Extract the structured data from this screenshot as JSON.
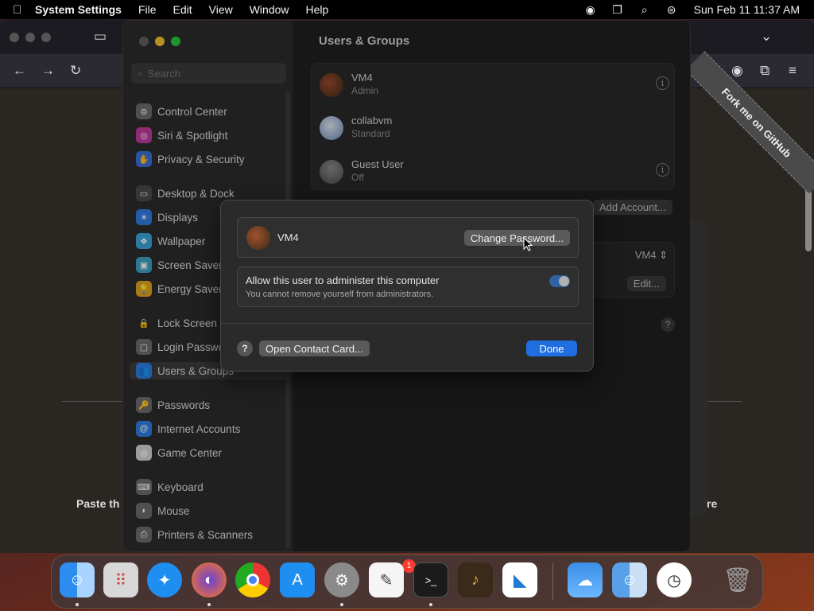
{
  "menubar": {
    "app_name": "System Settings",
    "menus": [
      "File",
      "Edit",
      "View",
      "Window",
      "Help"
    ],
    "clock": "Sun Feb 11  11:37 AM"
  },
  "browser": {
    "ribbon_text": "Fork me on GitHub",
    "page_text_left": "Paste th",
    "page_text_right": "efore"
  },
  "settings": {
    "search_placeholder": "Search",
    "sidebar_items": [
      {
        "label": "Control Center",
        "icon": "control-center-icon",
        "color": "#6b6b6b"
      },
      {
        "label": "Siri & Spotlight",
        "icon": "siri-icon",
        "color": "#c0399c"
      },
      {
        "label": "Privacy & Security",
        "icon": "hand-icon",
        "color": "#3a6fd8"
      },
      {
        "label": "Desktop & Dock",
        "icon": "dock-icon",
        "color": "#4a4a4a"
      },
      {
        "label": "Displays",
        "icon": "sun-icon",
        "color": "#2f7de0"
      },
      {
        "label": "Wallpaper",
        "icon": "wallpaper-icon",
        "color": "#3aa3d8"
      },
      {
        "label": "Screen Saver",
        "icon": "screen-saver-icon",
        "color": "#3d9fc2"
      },
      {
        "label": "Energy Saver",
        "icon": "bulb-icon",
        "color": "#e0a21f"
      },
      {
        "label": "Lock Screen",
        "icon": "lock-icon",
        "color": "#2b2b2b"
      },
      {
        "label": "Login Password",
        "icon": "login-password-icon",
        "color": "#6b6b6b"
      },
      {
        "label": "Users & Groups",
        "icon": "users-icon",
        "color": "#2f7de0"
      },
      {
        "label": "Passwords",
        "icon": "key-icon",
        "color": "#6b6b6b"
      },
      {
        "label": "Internet Accounts",
        "icon": "at-icon",
        "color": "#2f7de0"
      },
      {
        "label": "Game Center",
        "icon": "game-center-icon",
        "color": "#d0d0d0"
      },
      {
        "label": "Keyboard",
        "icon": "keyboard-icon",
        "color": "#6b6b6b"
      },
      {
        "label": "Mouse",
        "icon": "mouse-icon",
        "color": "#6b6b6b"
      },
      {
        "label": "Printers & Scanners",
        "icon": "printer-icon",
        "color": "#6b6b6b"
      }
    ],
    "main_title": "Users & Groups",
    "users": [
      {
        "name": "VM4",
        "role": "Admin"
      },
      {
        "name": "collabvm",
        "role": "Standard"
      },
      {
        "name": "Guest User",
        "role": "Off"
      }
    ],
    "add_account": "Add Account...",
    "auto_login_value": "VM4",
    "edit_label": "Edit..."
  },
  "sheet": {
    "user_name": "VM4",
    "change_password": "Change Password...",
    "admin_title": "Allow this user to administer this computer",
    "admin_subtitle": "You cannot remove yourself from administrators.",
    "admin_enabled": true,
    "help": "?",
    "open_contact": "Open Contact Card...",
    "done": "Done"
  },
  "dock": {
    "apps": [
      "Finder",
      "Launchpad",
      "Safari",
      "Firefox",
      "Chrome",
      "App Store",
      "System Settings",
      "TextEdit",
      "Terminal",
      "GarageBand",
      "Visual Studio Code",
      "Weather",
      "Migration Assistant",
      "Clock",
      "Trash"
    ],
    "settings_badge": "1"
  },
  "colors": {
    "accent": "#1f6fe0",
    "badge": "#ff3b30"
  }
}
